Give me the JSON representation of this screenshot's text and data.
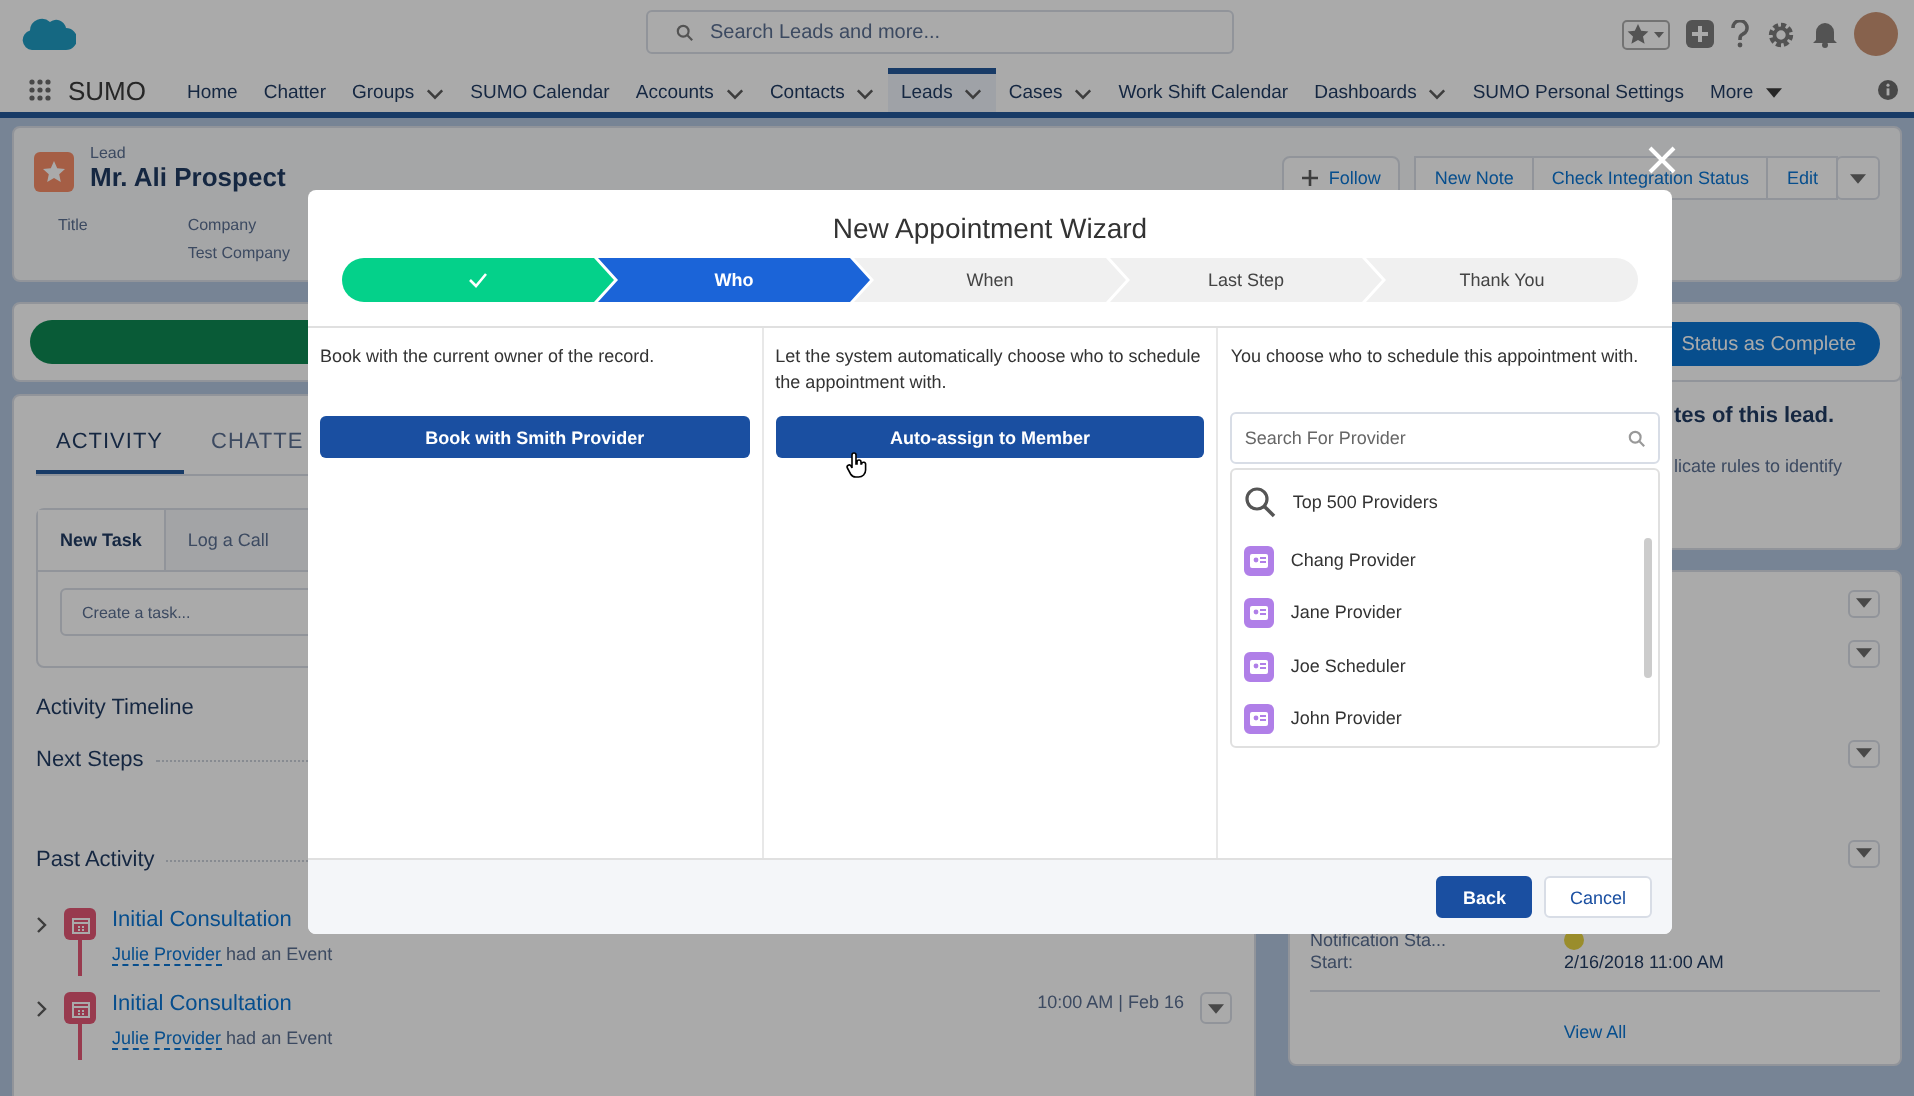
{
  "header": {
    "search_placeholder": "Search Leads and more..."
  },
  "nav": {
    "app_name": "SUMO",
    "tabs": [
      {
        "label": "Home",
        "selected": false,
        "dropdown": false
      },
      {
        "label": "Chatter",
        "selected": false,
        "dropdown": false
      },
      {
        "label": "Groups",
        "selected": false,
        "dropdown": true
      },
      {
        "label": "SUMO Calendar",
        "selected": false,
        "dropdown": false
      },
      {
        "label": "Accounts",
        "selected": false,
        "dropdown": true
      },
      {
        "label": "Contacts",
        "selected": false,
        "dropdown": true
      },
      {
        "label": "Leads",
        "selected": true,
        "dropdown": true
      },
      {
        "label": "Cases",
        "selected": false,
        "dropdown": true
      },
      {
        "label": "Work Shift Calendar",
        "selected": false,
        "dropdown": false
      },
      {
        "label": "Dashboards",
        "selected": false,
        "dropdown": true
      },
      {
        "label": "SUMO Personal Settings",
        "selected": false,
        "dropdown": false
      }
    ],
    "more": "More"
  },
  "record": {
    "type_label": "Lead",
    "name": "Mr. Ali Prospect",
    "follow": "Follow",
    "actions": [
      "New Note",
      "Check Integration Status",
      "Edit"
    ],
    "fields": [
      {
        "label": "Title"
      },
      {
        "label": "Company",
        "value": "Test Company"
      }
    ]
  },
  "path": {
    "complete_button": "Status as Complete"
  },
  "activity": {
    "tabs": [
      {
        "label": "ACTIVITY",
        "selected": true
      },
      {
        "label": "CHATTE",
        "selected": false
      }
    ],
    "composer_tabs": [
      {
        "label": "New Task",
        "selected": true
      },
      {
        "label": "Log a Call",
        "selected": false
      }
    ],
    "task_placeholder": "Create a task...",
    "sections": [
      "Activity Timeline",
      "Next Steps",
      "Past Activity"
    ],
    "timeline": [
      {
        "title": "Initial Consultation",
        "actor": "Julie Provider",
        "action": "had an Event"
      },
      {
        "title": "Initial Consultation",
        "actor": "Julie Provider",
        "action": "had an Event",
        "time": "10:00 AM | Feb 16"
      }
    ]
  },
  "side": {
    "note_title": "tes of this lead.",
    "note_text": "licate rules to identify",
    "event_fields": [
      {
        "label": "Notification Sta...",
        "kind": "status"
      },
      {
        "label": "Start:",
        "kind": "text",
        "value": "2/16/2018 11:00 AM"
      }
    ],
    "view_all": "View All"
  },
  "wizard": {
    "title": "New Appointment Wizard",
    "steps": [
      {
        "completed": true,
        "selected": false
      },
      {
        "label": "Who",
        "completed": false,
        "selected": true
      },
      {
        "label": "When",
        "completed": false,
        "selected": false
      },
      {
        "label": "Last Step",
        "completed": false,
        "selected": false
      },
      {
        "label": "Thank You",
        "completed": false,
        "selected": false
      }
    ],
    "options": [
      {
        "kind": "button",
        "description": "Book with the current owner of the record.",
        "button": "Book with Smith Provider"
      },
      {
        "kind": "button",
        "description": "Let the system automatically choose who to schedule the appointment with.",
        "button": "Auto-assign to Member"
      },
      {
        "kind": "search",
        "description": "You choose who to schedule this appointment with.",
        "placeholder": "Search For Provider",
        "top_option": "Top 500 Providers",
        "providers": [
          "Chang Provider",
          "Jane Provider",
          "Joe Scheduler",
          "John Provider"
        ]
      }
    ],
    "footer_buttons": [
      {
        "label": "Back",
        "kind": "primary"
      },
      {
        "label": "Cancel",
        "kind": "neutral"
      }
    ]
  }
}
